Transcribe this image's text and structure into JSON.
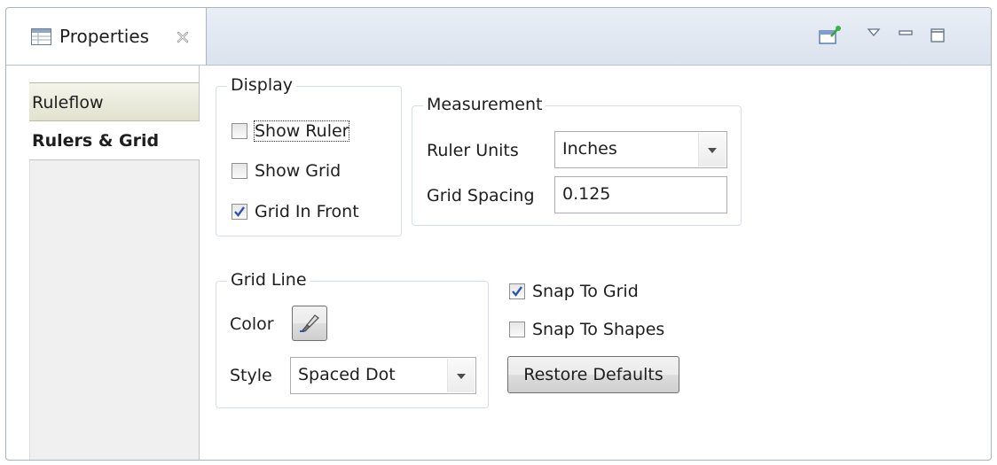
{
  "view": {
    "title": "Properties",
    "tab_icon": "properties-table-icon",
    "close_icon": "close-x-icon",
    "toolbar": [
      {
        "name": "pin-to-selection-icon"
      },
      {
        "name": "view-menu-icon"
      },
      {
        "name": "minimize-icon"
      },
      {
        "name": "maximize-icon"
      }
    ]
  },
  "sidebar": {
    "tabs": [
      {
        "label": "Ruleflow",
        "active": false
      },
      {
        "label": "Rulers & Grid",
        "active": true
      }
    ]
  },
  "display": {
    "legend": "Display",
    "show_ruler": {
      "label": "Show Ruler",
      "checked": false
    },
    "show_grid": {
      "label": "Show Grid",
      "checked": false
    },
    "grid_in_front": {
      "label": "Grid In Front",
      "checked": true
    }
  },
  "measurement": {
    "legend": "Measurement",
    "ruler_units_label": "Ruler Units",
    "ruler_units_value": "Inches",
    "grid_spacing_label": "Grid Spacing",
    "grid_spacing_value": "0.125"
  },
  "grid_line": {
    "legend": "Grid Line",
    "color_label": "Color",
    "color_button_icon": "paint-brush-icon",
    "style_label": "Style",
    "style_value": "Spaced Dot"
  },
  "snap": {
    "snap_to_grid": {
      "label": "Snap To Grid",
      "checked": true
    },
    "snap_to_shapes": {
      "label": "Snap To Shapes",
      "checked": false
    }
  },
  "restore_defaults_label": "Restore Defaults",
  "colors": {
    "border": "#a9b4c2",
    "group_border": "#d5dfe5",
    "check_blue": "#2b54b3"
  }
}
